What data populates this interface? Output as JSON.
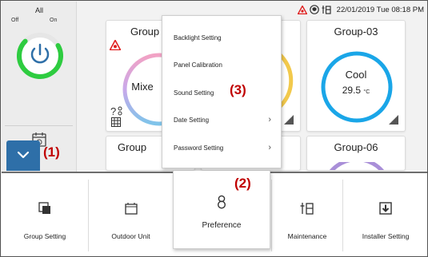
{
  "sidebar": {
    "all_label": "All",
    "off_label": "Off",
    "on_label": "On",
    "schedule_label": "Schedule"
  },
  "status_bar": {
    "datetime": "22/01/2019 Tue 08:18 PM",
    "icons": [
      "warning-icon",
      "shield-icon",
      "tools-icon"
    ]
  },
  "groups": [
    {
      "title": "Group",
      "mode": "Mixe",
      "temperature": "",
      "ring_color": "#d8a7e6"
    },
    {
      "title": "",
      "mode": "",
      "temperature": "",
      "ring_color": "#f2c94c"
    },
    {
      "title": "Group-03",
      "mode": "Cool",
      "temperature": "29.5",
      "unit": "°C",
      "ring_color": "#1aa6e8"
    },
    {
      "title": "Group",
      "mode": "",
      "temperature": "",
      "ring_color": "#cfcfcf"
    },
    {
      "title": "Group-06",
      "mode": "",
      "temperature": "",
      "ring_color": "#a98fd8"
    }
  ],
  "dropdown": {
    "items": [
      {
        "label": "Backlight Setting",
        "has_submenu": false
      },
      {
        "label": "Panel Calibration",
        "has_submenu": false
      },
      {
        "label": "Sound Setting",
        "has_submenu": false
      },
      {
        "label": "Date Setting",
        "has_submenu": true
      },
      {
        "label": "Password Setting",
        "has_submenu": true
      }
    ]
  },
  "bottom_menu": {
    "items": [
      {
        "label": "Group Setting",
        "icon": "group-setting-icon"
      },
      {
        "label": "Outdoor Unit",
        "icon": "outdoor-unit-icon"
      },
      {
        "label": "Preference",
        "icon": "preference-icon",
        "active": true
      },
      {
        "label": "Maintenance",
        "icon": "maintenance-icon"
      },
      {
        "label": "Installer Setting",
        "icon": "installer-setting-icon"
      }
    ]
  },
  "annotations": {
    "a1": "(1)",
    "a2": "(2)",
    "a3": "(3)"
  },
  "colors": {
    "accent": "#2e6fa8",
    "power_ring": "#2ecc40",
    "warning": "#e02020",
    "annotation": "#c00000"
  }
}
